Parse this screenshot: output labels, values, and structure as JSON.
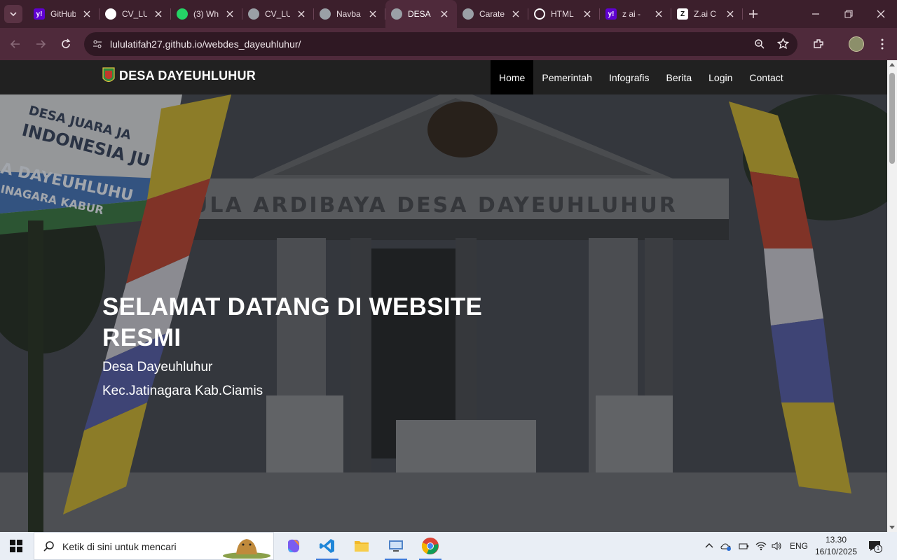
{
  "browser": {
    "tabs": [
      {
        "title": "GitHub",
        "favicon": "yahoo-icon",
        "color": "#6001d2"
      },
      {
        "title": "CV_LU",
        "favicon": "github-icon",
        "color": "#ffffff"
      },
      {
        "title": "(3) Wh",
        "favicon": "whatsapp-icon",
        "color": "#25d366"
      },
      {
        "title": "CV_LU",
        "favicon": "globe-icon",
        "color": "#9aa0a6"
      },
      {
        "title": "Navba",
        "favicon": "globe-icon",
        "color": "#9aa0a6"
      },
      {
        "title": "DESA",
        "favicon": "globe-icon",
        "color": "#9aa0a6",
        "active": true
      },
      {
        "title": "Carate",
        "favicon": "globe-icon",
        "color": "#9aa0a6"
      },
      {
        "title": "HTML",
        "favicon": "openai-icon",
        "color": "#ffffff"
      },
      {
        "title": "z ai - ",
        "favicon": "yahoo-icon",
        "color": "#6001d2"
      },
      {
        "title": "Z.ai C",
        "favicon": "zai-icon",
        "color": "#ffffff"
      }
    ],
    "url": "lululatifah27.github.io/webdes_dayeuhluhur/"
  },
  "site": {
    "brand": "DESA DAYEUHLUHUR",
    "menu": [
      "Home",
      "Pemerintah",
      "Infografis",
      "Berita",
      "Login",
      "Contact"
    ],
    "hero": {
      "title": "SELAMAT DATANG DI WEBSITE RESMI",
      "subtitle1": "Desa Dayeuhluhur",
      "subtitle2": "Kec.Jatinagara Kab.Ciamis"
    },
    "photo_text": {
      "building_sign": "ULA ARDIBAYA DESA DAYEUHLUHUR",
      "board_line1": "DESA JUARA JA",
      "board_line2": "INDONESIA JU",
      "board_line3": "A DAYEUHLUHU",
      "board_line4": "INAGARA KABUR"
    }
  },
  "taskbar": {
    "search_placeholder": "Ketik di sini untuk mencari",
    "language": "ENG",
    "time": "13.30",
    "date": "16/10/2025",
    "notification_count": "1"
  }
}
